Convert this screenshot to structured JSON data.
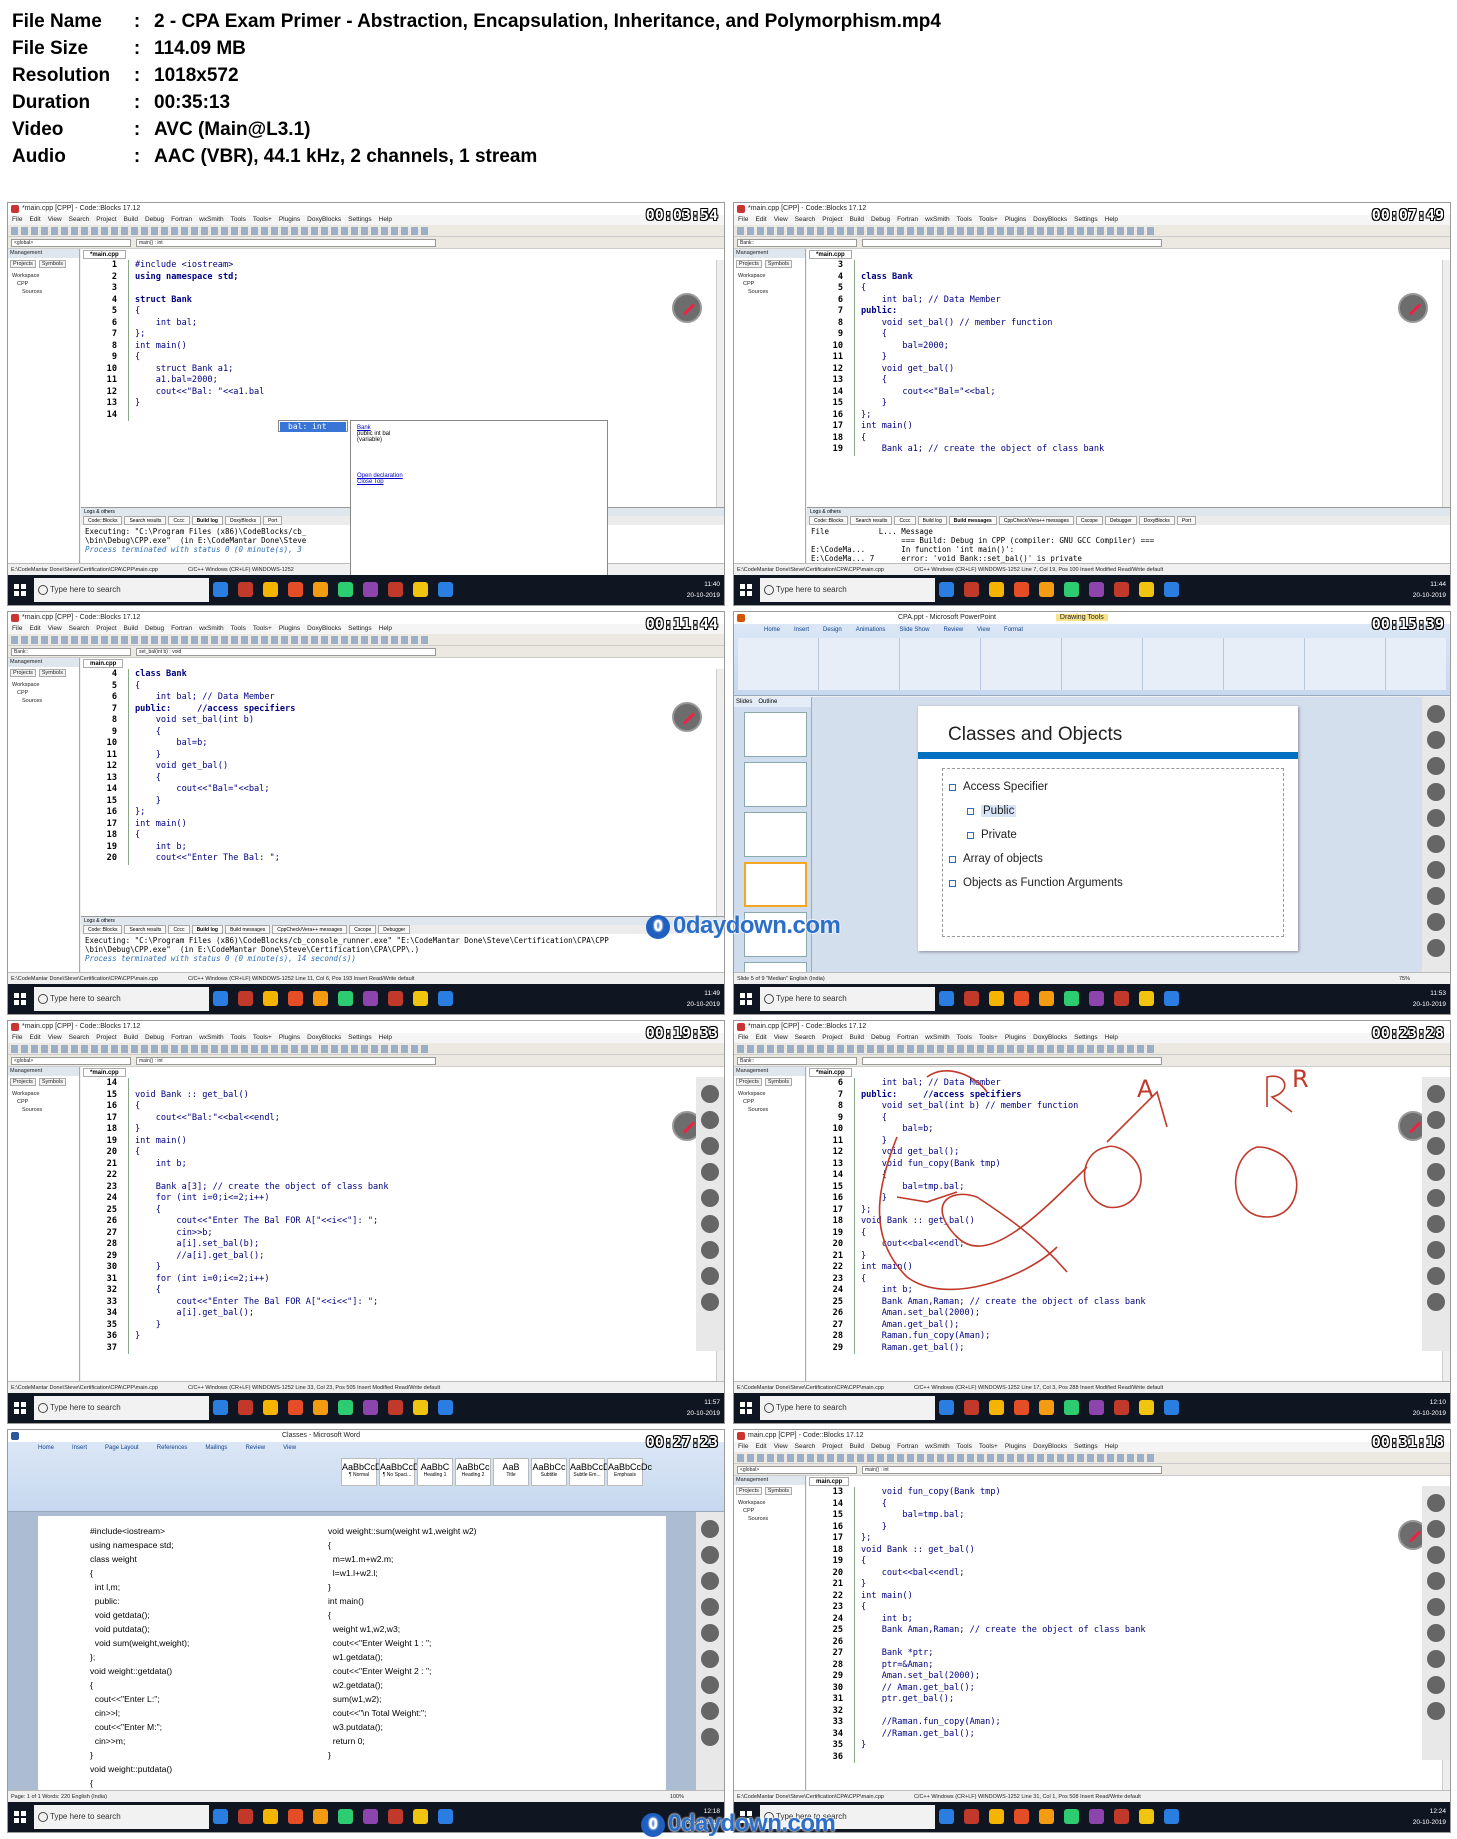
{
  "file_info": [
    {
      "key": "File Name",
      "value": "2 - CPA Exam Primer - Abstraction, Encapsulation, Inheritance, and Polymorphism.mp4"
    },
    {
      "key": "File Size",
      "value": "114.09 MB"
    },
    {
      "key": "Resolution",
      "value": "1018x572"
    },
    {
      "key": "Duration",
      "value": "00:35:13"
    },
    {
      "key": "Video",
      "value": "AVC (Main@L3.1)"
    },
    {
      "key": "Audio",
      "value": "AAC (VBR), 44.1 kHz, 2 channels, 1 stream"
    }
  ],
  "colon": ":",
  "common": {
    "cb_title": "*main.cpp [CPP] - Code::Blocks 17.12",
    "cb_title_saved": "main.cpp [CPP] - Code::Blocks 17.12",
    "menu": [
      "File",
      "Edit",
      "View",
      "Search",
      "Project",
      "Build",
      "Debug",
      "Fortran",
      "wxSmith",
      "Tools",
      "Tools+",
      "Plugins",
      "DoxyBlocks",
      "Settings",
      "Help"
    ],
    "mgmt_header": "Management",
    "mgmt_tabs": [
      "Projects",
      "Symbols"
    ],
    "tree": [
      "Workspace",
      "CPP",
      "Sources"
    ],
    "editor_tab": "*main.cpp",
    "editor_tab_saved": "main.cpp",
    "logs_header": "Logs & others",
    "status_path": "E:\\CodeMantar Done\\Steve\\Certification\\CPA\\CPP\\main.cpp",
    "search": "Type here to search",
    "tray_lang": "ENG",
    "date": "20-10-2019",
    "watermark": "0daydown.com"
  },
  "thumbs": [
    {
      "time": "00:03:54",
      "combo1": "<global>",
      "combo2": "main() : int",
      "code": [
        [
          "1",
          "#include <iostream>",
          "pp"
        ],
        [
          "2",
          "using namespace std;",
          "kw"
        ],
        [
          "3",
          "",
          ""
        ],
        [
          "4",
          "struct Bank",
          "kw"
        ],
        [
          "5",
          "{",
          ""
        ],
        [
          "6",
          "    int bal;",
          ""
        ],
        [
          "7",
          "};",
          ""
        ],
        [
          "8",
          "int main()",
          ""
        ],
        [
          "9",
          "{",
          ""
        ],
        [
          "10",
          "    struct Bank a1;",
          ""
        ],
        [
          "11",
          "    a1.bal=2000;",
          ""
        ],
        [
          "12",
          "    cout<<\"Bal: \"<<a1.bal",
          ""
        ],
        [
          "13",
          "}",
          ""
        ],
        [
          "14",
          "",
          ""
        ]
      ],
      "popup_item": "bal: int",
      "popup_doc": [
        "Bank",
        "public int bal",
        "(variable)",
        "Open declaration",
        "Close Top"
      ],
      "log_tabs": [
        "Code::Blocks",
        "Search results",
        "Cccc",
        "Build log",
        "DoxyBlocks",
        "Port"
      ],
      "log_active": "Build log",
      "logs": [
        "Executing: \"C:\\Program Files (x86)\\CodeBlocks/cb_",
        "\\bin\\Debug\\CPP.exe\"  (in E:\\CodeMantar Done\\Steve",
        "Process terminated with status 0 (0 minute(s), 3"
      ],
      "status": "C/C++    Windows (CR+LF)    WINDOWS-1252",
      "clock": "11:40"
    },
    {
      "time": "00:07:49",
      "combo1": "Bank::",
      "combo2": "",
      "code": [
        [
          "3",
          "",
          ""
        ],
        [
          "4",
          "class Bank",
          "kw"
        ],
        [
          "5",
          "{",
          ""
        ],
        [
          "6",
          "    int bal; // Data Member",
          ""
        ],
        [
          "7",
          "public:",
          "kw"
        ],
        [
          "8",
          "    void set_bal() // member function",
          ""
        ],
        [
          "9",
          "    {",
          ""
        ],
        [
          "10",
          "        bal=2000;",
          ""
        ],
        [
          "11",
          "    }",
          ""
        ],
        [
          "12",
          "    void get_bal()",
          ""
        ],
        [
          "13",
          "    {",
          ""
        ],
        [
          "14",
          "        cout<<\"Bal=\"<<bal;",
          ""
        ],
        [
          "15",
          "    }",
          ""
        ],
        [
          "16",
          "};",
          ""
        ],
        [
          "17",
          "int main()",
          ""
        ],
        [
          "18",
          "{",
          ""
        ],
        [
          "19",
          "    Bank a1; // create the object of class bank",
          ""
        ]
      ],
      "log_tabs": [
        "Code::Blocks",
        "Search results",
        "Cccc",
        "Build log",
        "Build messages",
        "CppCheck/Vera++ messages",
        "Cscope",
        "Debugger",
        "DoxyBlocks",
        "Port"
      ],
      "log_active": "Build messages",
      "logs": [
        "File           L... Message",
        "                    === Build: Debug in CPP (compiler: GNU GCC Compiler) ===",
        "E:\\CodeMa...        In function 'int main()':",
        "E:\\CodeMa... 7      error: 'void Bank::set_bal()' is private"
      ],
      "status": "C/C++    Windows (CR+LF)    WINDOWS-1252    Line 7, Col 19, Pos 100    Insert    Modified    Read/Write    default",
      "clock": "11:44"
    },
    {
      "time": "00:11:44",
      "combo1": "Bank::",
      "combo2": "set_bal(int b) : void",
      "code": [
        [
          "4",
          "class Bank",
          "kw"
        ],
        [
          "5",
          "{",
          ""
        ],
        [
          "6",
          "    int bal; // Data Member",
          ""
        ],
        [
          "7",
          "public:     //access specifiers",
          "kw"
        ],
        [
          "8",
          "    void set_bal(int b)",
          ""
        ],
        [
          "9",
          "    {",
          ""
        ],
        [
          "10",
          "        bal=b;",
          ""
        ],
        [
          "11",
          "    }",
          ""
        ],
        [
          "12",
          "    void get_bal()",
          ""
        ],
        [
          "13",
          "    {",
          ""
        ],
        [
          "14",
          "        cout<<\"Bal=\"<<bal;",
          ""
        ],
        [
          "15",
          "    }",
          ""
        ],
        [
          "16",
          "};",
          ""
        ],
        [
          "17",
          "int main()",
          ""
        ],
        [
          "18",
          "{",
          ""
        ],
        [
          "19",
          "    int b;",
          ""
        ],
        [
          "20",
          "    cout<<\"Enter The Bal: \";",
          ""
        ]
      ],
      "log_tabs": [
        "Code::Blocks",
        "Search results",
        "Cccc",
        "Build log",
        "Build messages",
        "CppCheck/Vera++ messages",
        "Cscope",
        "Debugger"
      ],
      "log_active": "Build log",
      "logs": [
        "Executing: \"C:\\Program Files (x86)\\CodeBlocks/cb_console_runner.exe\" \"E:\\CodeMantar Done\\Steve\\Certification\\CPA\\CPP",
        "\\bin\\Debug\\CPP.exe\"  (in E:\\CodeMantar Done\\Steve\\Certification\\CPA\\CPP\\.)",
        "Process terminated with status 0 (0 minute(s), 14 second(s))"
      ],
      "status": "C/C++    Windows (CR+LF)    WINDOWS-1252    Line 11, Col 6, Pos 193    Insert    Read/Write    default",
      "clock": "11:49"
    },
    {
      "time": "00:15:39",
      "ppt_title": "CPA.ppt - Microsoft PowerPoint",
      "ppt_tool": "Drawing Tools",
      "ppt_tabs": [
        "Home",
        "Insert",
        "Design",
        "Animations",
        "Slide Show",
        "Review",
        "View",
        "Format"
      ],
      "pane_tabs": [
        "Slides",
        "Outline"
      ],
      "slide_title": "Classes and Objects",
      "bullets": [
        {
          "text": "Access Specifier",
          "level": 1
        },
        {
          "text": "Public",
          "level": 2
        },
        {
          "text": "Private",
          "level": 2
        },
        {
          "text": "Array of objects",
          "level": 1
        },
        {
          "text": "Objects as Function Arguments",
          "level": 1
        }
      ],
      "status": "Slide 5 of 9    \"Median\"    English (India)",
      "zoom": "75%",
      "clock": "11:53"
    },
    {
      "time": "00:19:33",
      "combo1": "<global>",
      "combo2": "main() : int",
      "code": [
        [
          "14",
          "",
          ""
        ],
        [
          "15",
          "void Bank :: get_bal()",
          ""
        ],
        [
          "16",
          "{",
          ""
        ],
        [
          "17",
          "    cout<<\"Bal:\"<<bal<<endl;",
          ""
        ],
        [
          "18",
          "}",
          ""
        ],
        [
          "19",
          "int main()",
          ""
        ],
        [
          "20",
          "{",
          ""
        ],
        [
          "21",
          "    int b;",
          ""
        ],
        [
          "22",
          "",
          ""
        ],
        [
          "23",
          "    Bank a[3]; // create the object of class bank",
          ""
        ],
        [
          "24",
          "    for (int i=0;i<=2;i++)",
          ""
        ],
        [
          "25",
          "    {",
          ""
        ],
        [
          "26",
          "        cout<<\"Enter The Bal FOR A[\"<<i<<\"]: \";",
          ""
        ],
        [
          "27",
          "        cin>>b;",
          ""
        ],
        [
          "28",
          "        a[i].set_bal(b);",
          ""
        ],
        [
          "29",
          "        //a[i].get_bal();",
          ""
        ],
        [
          "30",
          "    }",
          ""
        ],
        [
          "31",
          "    for (int i=0;i<=2;i++)",
          ""
        ],
        [
          "32",
          "    {",
          ""
        ],
        [
          "33",
          "        cout<<\"Enter The Bal FOR A[\"<<i<<\"]: \";",
          ""
        ],
        [
          "34",
          "        a[i].get_bal();",
          ""
        ],
        [
          "35",
          "    }",
          ""
        ],
        [
          "36",
          "}",
          ""
        ],
        [
          "37",
          "",
          ""
        ]
      ],
      "status": "C/C++    Windows (CR+LF)    WINDOWS-1252    Line 33, Col 23, Pos 505    Insert    Modified    Read/Write    default",
      "clock": "11:57"
    },
    {
      "time": "00:23:28",
      "combo1": "Bank::",
      "combo2": "",
      "code": [
        [
          "6",
          "    int bal; // Data Member",
          ""
        ],
        [
          "7",
          "public:     //access specifiers",
          "kw"
        ],
        [
          "8",
          "    void set_bal(int b) // member function",
          ""
        ],
        [
          "9",
          "    {",
          ""
        ],
        [
          "10",
          "        bal=b;",
          ""
        ],
        [
          "11",
          "    }",
          ""
        ],
        [
          "12",
          "    void get_bal();",
          ""
        ],
        [
          "13",
          "    void fun_copy(Bank tmp)",
          ""
        ],
        [
          "14",
          "    {",
          ""
        ],
        [
          "15",
          "        bal=tmp.bal;",
          ""
        ],
        [
          "16",
          "    }",
          ""
        ],
        [
          "17",
          "};",
          ""
        ],
        [
          "18",
          "void Bank :: get_bal()",
          ""
        ],
        [
          "19",
          "{",
          ""
        ],
        [
          "20",
          "    cout<<bal<<endl;",
          ""
        ],
        [
          "21",
          "}",
          ""
        ],
        [
          "22",
          "int main()",
          ""
        ],
        [
          "23",
          "{",
          ""
        ],
        [
          "24",
          "    int b;",
          ""
        ],
        [
          "25",
          "    Bank Aman,Raman; // create the object of class bank",
          ""
        ],
        [
          "26",
          "    Aman.set_bal(2000);",
          ""
        ],
        [
          "27",
          "    Aman.get_bal();",
          ""
        ],
        [
          "28",
          "    Raman.fun_copy(Aman);",
          ""
        ],
        [
          "29",
          "    Raman.get_bal();",
          ""
        ]
      ],
      "scrib_labels": [
        "A",
        "R"
      ],
      "status": "C/C++    Windows (CR+LF)    WINDOWS-1252    Line 17, Col 3, Pos 288    Insert    Modified    Read/Write    default",
      "clock": "12:10"
    },
    {
      "time": "00:27:23",
      "word_title": "Classes - Microsoft Word",
      "word_tabs": [
        "Home",
        "Insert",
        "Page Layout",
        "References",
        "Mailings",
        "Review",
        "View"
      ],
      "word_styles": [
        [
          "AaBbCcDc",
          "¶ Normal"
        ],
        [
          "AaBbCcDc",
          "¶ No Spaci..."
        ],
        [
          "AaBbC",
          "Heading 1"
        ],
        [
          "AaBbCc",
          "Heading 2"
        ],
        [
          "AaB",
          "Title"
        ],
        [
          "AaBbCc",
          "Subtitle"
        ],
        [
          "AaBbCcDc",
          "Subtle Em..."
        ],
        [
          "AaBbCcDc",
          "Emphasis"
        ]
      ],
      "col1": [
        "#include<iostream>",
        "using namespace std;",
        "class weight",
        "{",
        "  int l,m;",
        "  public:",
        "  void getdata();",
        "  void putdata();",
        "  void sum(weight,weight);",
        "};",
        "void weight::getdata()",
        "{",
        "  cout<<\"Enter L:\";",
        "  cin>>l;",
        "  cout<<\"Enter M:\";",
        "  cin>>m;",
        "}",
        "void weight::putdata()",
        "{",
        "  cout<<\"L=\"<<l<<\" M=\"<<m<<endl;"
      ],
      "col2": [
        "void weight::sum(weight w1,weight w2)",
        "{",
        "  m=w1.m+w2.m;",
        "  l=w1.l+w2.l;",
        "}",
        "int main()",
        "{",
        "  weight w1,w2,w3;",
        "  cout<<\"Enter Weight 1 : \";",
        "  w1.getdata();",
        "  cout<<\"Enter Weight 2 : \";",
        "  w2.getdata();",
        "  sum(w1,w2);",
        "  cout<<\"\\n Total Weight:\";",
        "  w3.putdata();",
        "  return 0;",
        "}"
      ],
      "status": "Page: 1 of 1    Words: 220    English (India)",
      "zoom": "100%",
      "clock": "12:18"
    },
    {
      "time": "00:31:18",
      "combo1": "<global>",
      "combo2": "main() : int",
      "code": [
        [
          "13",
          "    void fun_copy(Bank tmp)",
          ""
        ],
        [
          "14",
          "    {",
          ""
        ],
        [
          "15",
          "        bal=tmp.bal;",
          ""
        ],
        [
          "16",
          "    }",
          ""
        ],
        [
          "17",
          "};",
          ""
        ],
        [
          "18",
          "void Bank :: get_bal()",
          ""
        ],
        [
          "19",
          "{",
          ""
        ],
        [
          "20",
          "    cout<<bal<<endl;",
          ""
        ],
        [
          "21",
          "}",
          ""
        ],
        [
          "22",
          "int main()",
          ""
        ],
        [
          "23",
          "{",
          ""
        ],
        [
          "24",
          "    int b;",
          ""
        ],
        [
          "25",
          "    Bank Aman,Raman; // create the object of class bank",
          ""
        ],
        [
          "26",
          "",
          ""
        ],
        [
          "27",
          "    Bank *ptr;",
          ""
        ],
        [
          "28",
          "    ptr=&Aman;",
          ""
        ],
        [
          "29",
          "    Aman.set_bal(2000);",
          ""
        ],
        [
          "30",
          "    // Aman.get_bal();",
          ""
        ],
        [
          "31",
          "    ptr.get_bal();",
          ""
        ],
        [
          "32",
          "",
          ""
        ],
        [
          "33",
          "    //Raman.fun_copy(Aman);",
          ""
        ],
        [
          "34",
          "    //Raman.get_bal();",
          ""
        ],
        [
          "35",
          "}",
          ""
        ],
        [
          "36",
          "",
          ""
        ]
      ],
      "status": "C/C++    Windows (CR+LF)    WINDOWS-1252    Line 31, Col 1, Pos 508    Insert    Read/Write    default",
      "clock": "12:24"
    }
  ],
  "taskbar_colors": [
    "#2a7de1",
    "#c0392b",
    "#f4b400",
    "#e44d26",
    "#f39c12",
    "#2ecc71",
    "#8e44ad",
    "#c0392b",
    "#f1c40f",
    "#2a7de1"
  ]
}
